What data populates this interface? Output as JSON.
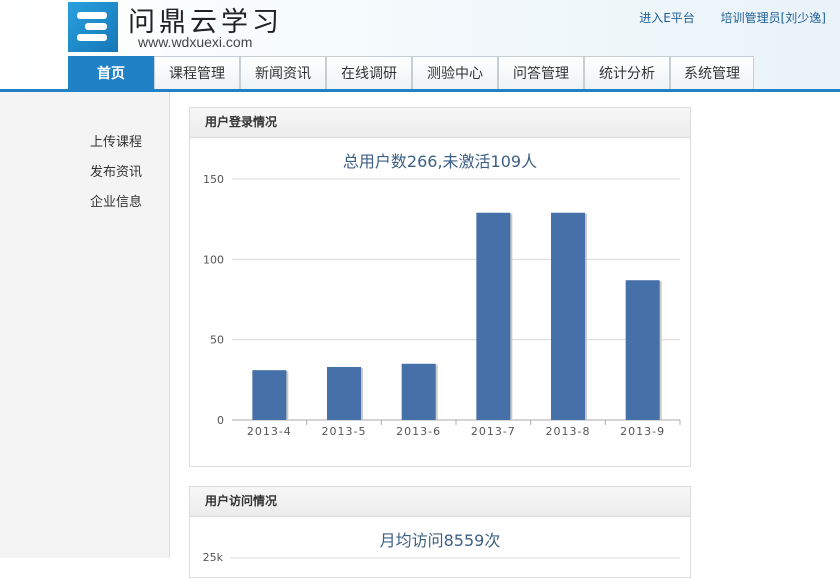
{
  "header": {
    "site_title": "问鼎云学习",
    "site_url": "www.wdxuexi.com",
    "links": [
      "进入E平台",
      "培训管理员[刘少逸]"
    ]
  },
  "nav": {
    "tabs": [
      "首页",
      "课程管理",
      "新闻资讯",
      "在线调研",
      "测验中心",
      "问答管理",
      "统计分析",
      "系统管理"
    ],
    "active": "首页"
  },
  "sidebar": {
    "items": [
      "上传课程",
      "发布资讯",
      "企业信息"
    ]
  },
  "panels": {
    "login": {
      "heading": "用户登录情况"
    },
    "visits": {
      "heading": "用户访问情况",
      "chart_title": "月均访问8559次",
      "first_tick": "25k"
    }
  },
  "colors": {
    "accent": "#2181c6",
    "bar": "#4670a8"
  },
  "chart_data": [
    {
      "type": "bar",
      "title": "总用户数266,未激活109人",
      "categories": [
        "2013-4",
        "2013-5",
        "2013-6",
        "2013-7",
        "2013-8",
        "2013-9"
      ],
      "values": [
        31,
        33,
        35,
        129,
        129,
        87
      ],
      "yticks": [
        0,
        50,
        100,
        150
      ],
      "ylim": [
        0,
        150
      ],
      "grid": true
    }
  ]
}
